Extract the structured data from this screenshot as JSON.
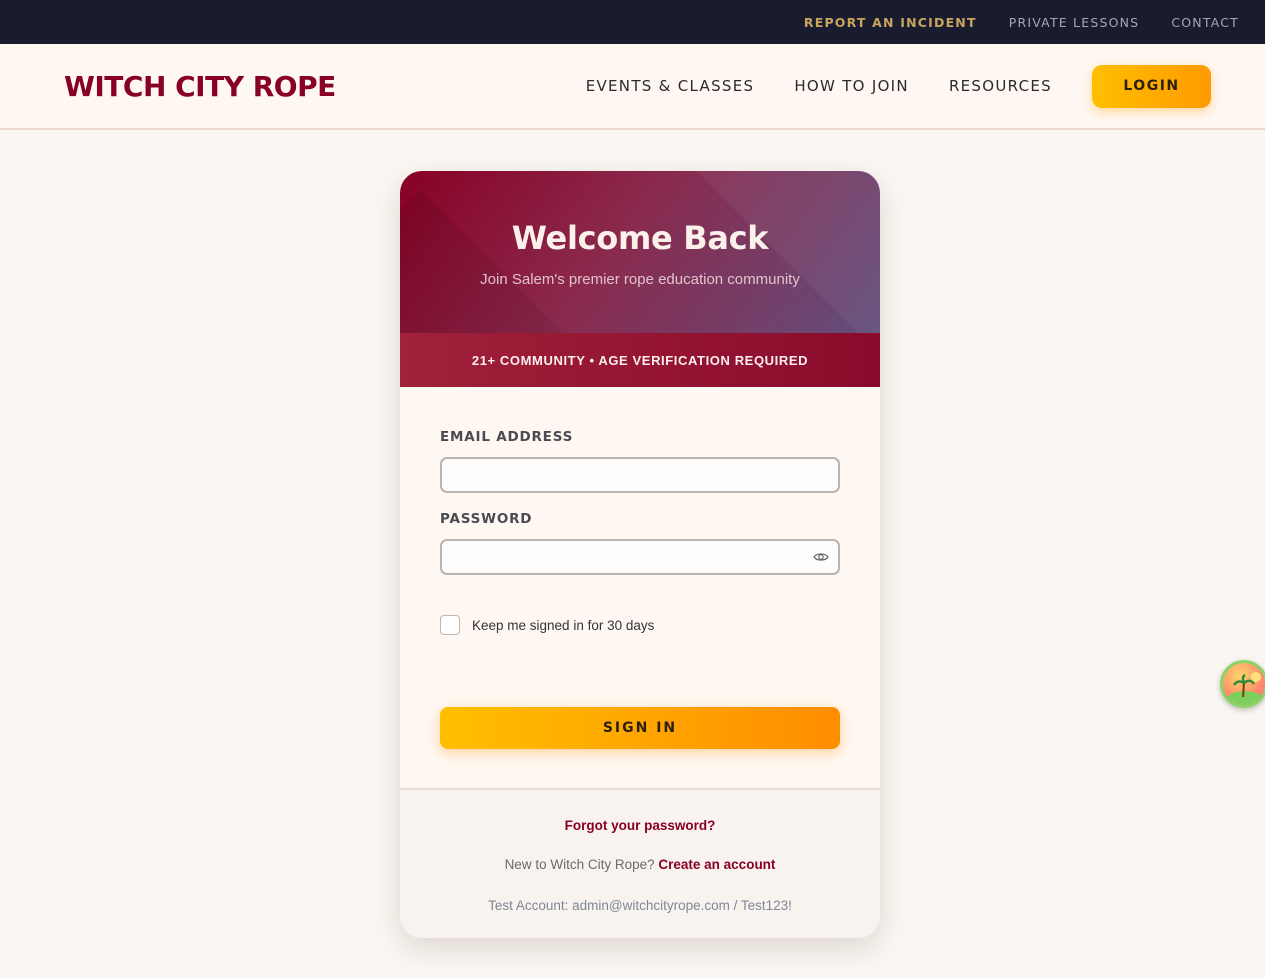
{
  "utility_nav": {
    "report": "REPORT AN INCIDENT",
    "private_lessons": "PRIVATE LESSONS",
    "contact": "CONTACT"
  },
  "header": {
    "logo": "WITCH CITY ROPE",
    "nav": {
      "events": "EVENTS & CLASSES",
      "join": "HOW TO JOIN",
      "resources": "RESOURCES"
    },
    "login_label": "LOGIN"
  },
  "card": {
    "title": "Welcome Back",
    "subtitle": "Join Salem's premier rope education community",
    "age_banner": "21+ COMMUNITY • AGE VERIFICATION REQUIRED",
    "email_label": "EMAIL ADDRESS",
    "email_value": "",
    "password_label": "PASSWORD",
    "password_value": "",
    "remember_label": "Keep me signed in for 30 days",
    "remember_checked": false,
    "signin_label": "SIGN IN",
    "forgot_label": "Forgot your password?",
    "new_prefix": "New to Witch City Rope?",
    "create_label": "Create an account",
    "test_account": "Test Account: admin@witchcityrope.com / Test123!"
  },
  "icons": {
    "password_toggle": "eye-icon",
    "floating_widget": "island-icon"
  },
  "colors": {
    "brand": "#880124",
    "accent_gold": "#c9a45c",
    "button_gradient_start": "#ffbf00",
    "button_gradient_end": "#ff8d00",
    "utility_bar": "#191b2e"
  }
}
